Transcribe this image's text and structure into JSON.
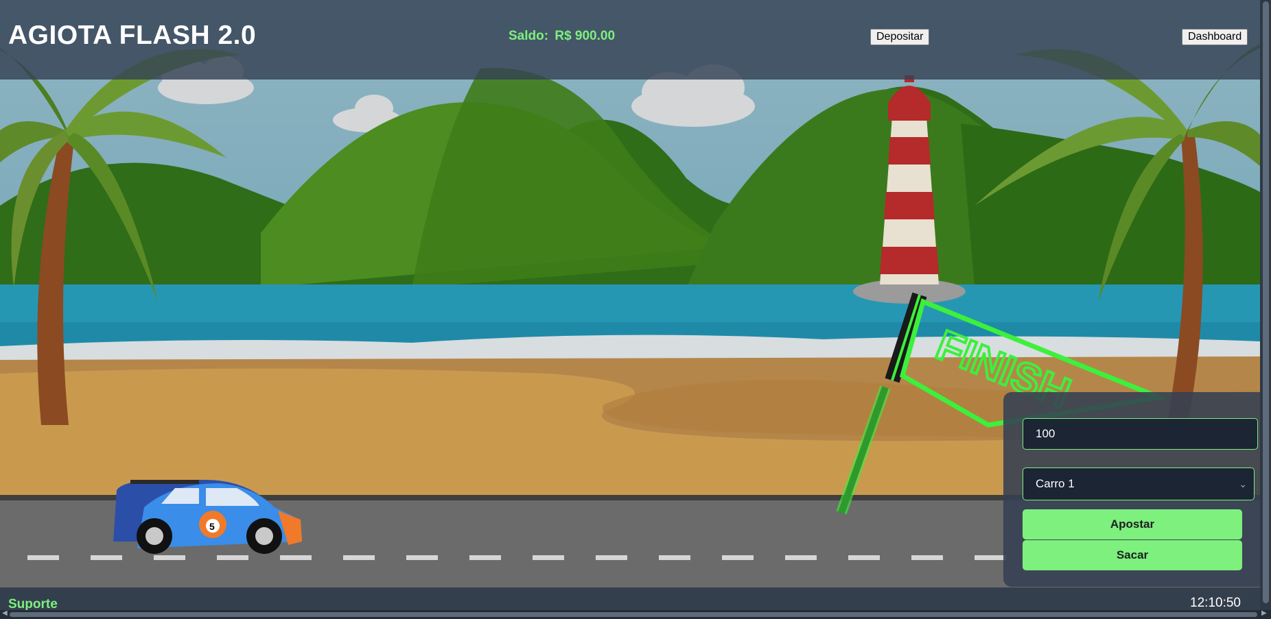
{
  "header": {
    "title": "AGIOTA FLASH 2.0",
    "balance_label": "Saldo:",
    "balance_value": "R$ 900.00",
    "deposit_label": "Depositar",
    "dashboard_label": "Dashboard"
  },
  "scene": {
    "finish_text": "FINISH",
    "car_number": "5"
  },
  "bet_panel": {
    "amount_value": "100",
    "car_selected": "Carro 1",
    "bet_button": "Apostar",
    "withdraw_button": "Sacar"
  },
  "footer": {
    "support_label": "Suporte",
    "clock": "12:10:50"
  },
  "colors": {
    "accent": "#7df07d",
    "header_bg": "#344254",
    "panel_bg": "#344052",
    "input_bg": "#1b2533"
  },
  "icons": [
    "chevron-down-icon",
    "palm-tree",
    "lighthouse",
    "finish-flag",
    "race-car"
  ]
}
